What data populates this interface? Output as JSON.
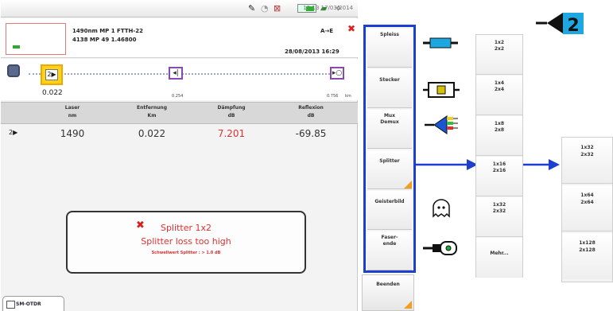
{
  "statusbar": {
    "time": "13:13  17/03/2014",
    "battery": "100%"
  },
  "info": {
    "line1": "1490nm   MP 1  FTTH-22",
    "line2": "4138 MP 49     1.46800",
    "direction": "A→E",
    "date": "28/08/2013  16:29"
  },
  "trace": {
    "pos_main": "0.022",
    "pos_mid": "0.254",
    "pos_end": "0.756",
    "pos_end_unit": "km"
  },
  "table": {
    "headers": [
      {
        "title": "Laser",
        "unit": "nm"
      },
      {
        "title": "Entfernung",
        "unit": "Km"
      },
      {
        "title": "Dämpfung",
        "unit": "dB"
      },
      {
        "title": "Reflexion",
        "unit": "dB"
      }
    ],
    "row": {
      "laser": "1490",
      "distance": "0.022",
      "attenuation": "7.201",
      "reflection": "-69.85"
    }
  },
  "alert": {
    "line1": "Splitter 1x2",
    "line2": "Splitter loss too high",
    "line3": "Schwellwert Splitter : > 1.0 dB"
  },
  "tab": {
    "label": "SM-OTDR"
  },
  "menu": {
    "items": [
      {
        "line1": "Spleiss",
        "line2": ""
      },
      {
        "line1": "Stecker",
        "line2": ""
      },
      {
        "line1": "Mux",
        "line2": "Demux"
      },
      {
        "line1": "Splitter",
        "line2": ""
      },
      {
        "line1": "Geisterbild",
        "line2": ""
      },
      {
        "line1": "Faser-",
        "line2": "ende"
      }
    ],
    "quit": "Beenden"
  },
  "splitter_list1": [
    {
      "a": "1x2",
      "b": "2x2"
    },
    {
      "a": "1x4",
      "b": "2x4"
    },
    {
      "a": "1x8",
      "b": "2x8"
    },
    {
      "a": "1x16",
      "b": "2x16"
    },
    {
      "a": "1x32",
      "b": "2x32"
    },
    {
      "a": "Mehr...",
      "b": ""
    }
  ],
  "splitter_list2": [
    {
      "a": "1x32",
      "b": "2x32"
    },
    {
      "a": "1x64",
      "b": "2x64"
    },
    {
      "a": "1x128",
      "b": "2x128"
    }
  ],
  "badge": {
    "number": "2"
  },
  "colors": {
    "accent_blue": "#1d3fcf",
    "alert_red": "#e03030",
    "highlight_yellow": "#ffd31a"
  }
}
